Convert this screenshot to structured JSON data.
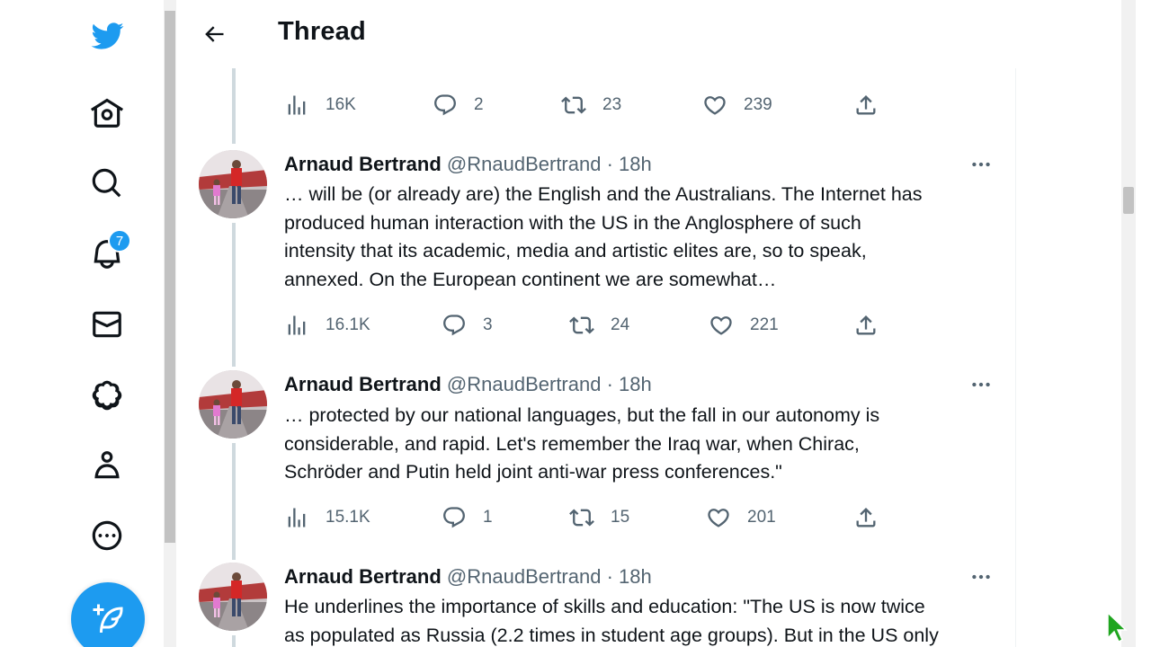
{
  "nav": {
    "notifications_badge": "7",
    "items": [
      {
        "icon": "twitter-logo-icon"
      },
      {
        "icon": "home-icon"
      },
      {
        "icon": "search-icon"
      },
      {
        "icon": "bell-icon"
      },
      {
        "icon": "mail-icon"
      },
      {
        "icon": "twitter-blue-icon"
      },
      {
        "icon": "profile-icon"
      },
      {
        "icon": "more-circle-icon"
      }
    ],
    "compose_icon": "feather-plus-icon"
  },
  "header": {
    "title": "Thread"
  },
  "top_actions": {
    "views": "16K",
    "replies": "2",
    "retweets": "23",
    "likes": "239"
  },
  "tweets": [
    {
      "name": "Arnaud Bertrand",
      "handle": "@RnaudBertrand",
      "dot": "·",
      "time": "18h",
      "lines": [
        "… will be (or already are) the English and the Australians. The Internet has",
        "produced human interaction with the US in the Anglosphere of such",
        "intensity that its academic, media and artistic elites are, so to speak,",
        "annexed. On the European continent we are somewhat…"
      ],
      "views": "16.1K",
      "replies": "3",
      "retweets": "24",
      "likes": "221"
    },
    {
      "name": "Arnaud Bertrand",
      "handle": "@RnaudBertrand",
      "dot": "·",
      "time": "18h",
      "lines": [
        "… protected by our national languages, but the fall in our autonomy is",
        "considerable, and rapid. Let's remember the Iraq war, when Chirac,",
        "Schröder and Putin held joint anti-war press conferences.\""
      ],
      "views": "15.1K",
      "replies": "1",
      "retweets": "15",
      "likes": "201"
    },
    {
      "name": "Arnaud Bertrand",
      "handle": "@RnaudBertrand",
      "dot": "·",
      "time": "18h",
      "lines": [
        "He underlines the importance of skills and education: \"The US is now twice",
        "as populated as Russia (2.2 times in student age groups). But in the US only"
      ]
    }
  ],
  "colors": {
    "brand": "#1d9bf0",
    "text": "#0f1419",
    "muted": "#536471",
    "thread_line": "#cfd9de"
  }
}
